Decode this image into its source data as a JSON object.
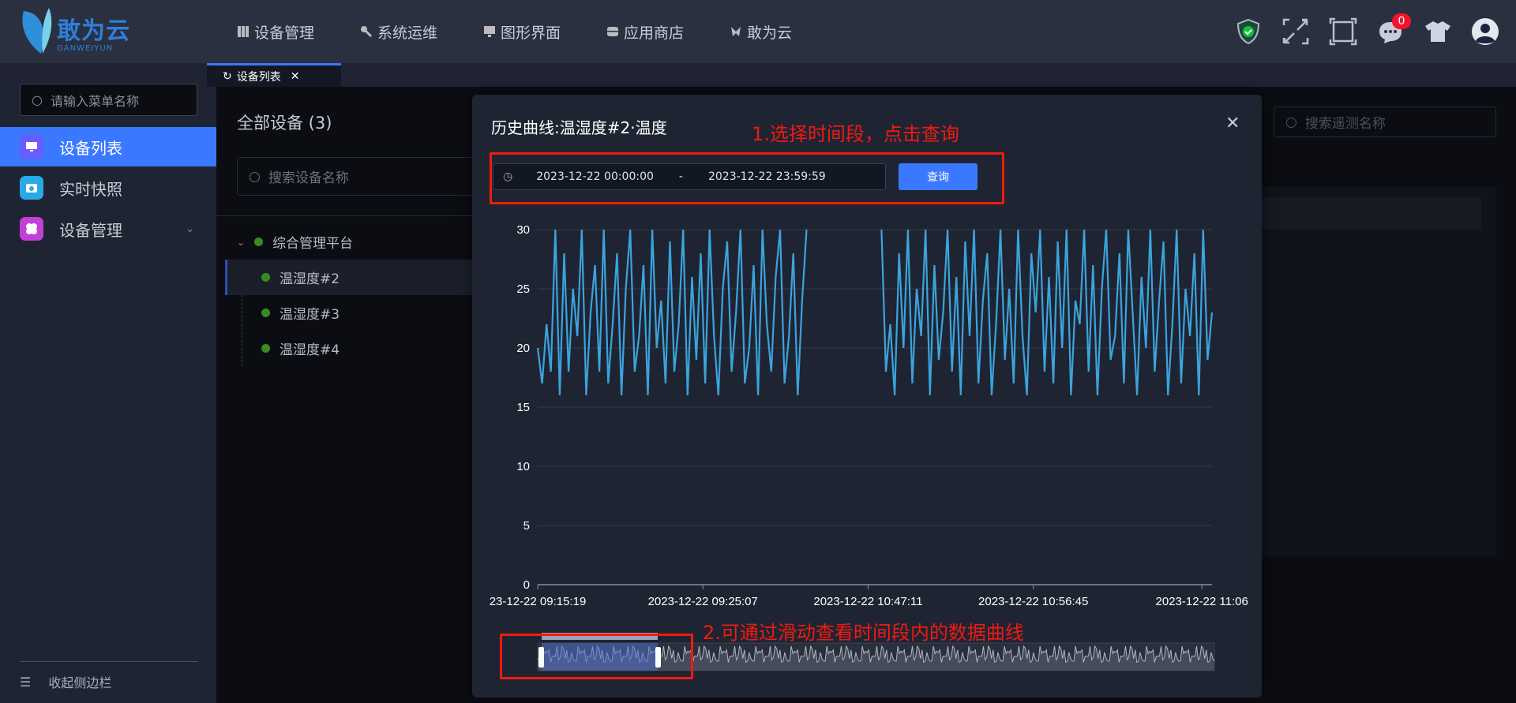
{
  "header": {
    "logo_text": "敢为云",
    "logo_subtext": "GANWEIYUN",
    "nav": [
      {
        "label": "设备管理",
        "icon": "columns-icon"
      },
      {
        "label": "系统运维",
        "icon": "wrench-icon"
      },
      {
        "label": "图形界面",
        "icon": "monitor-icon"
      },
      {
        "label": "应用商店",
        "icon": "store-icon"
      },
      {
        "label": "敢为云",
        "icon": "butterfly-icon"
      }
    ],
    "message_count": "0"
  },
  "tabs": [
    {
      "label": "设备列表"
    }
  ],
  "sidebar": {
    "search_placeholder": "请输入菜单名称",
    "items": [
      {
        "label": "设备列表",
        "icon": "monitor-icon",
        "color": "#6a5cff",
        "active": true
      },
      {
        "label": "实时快照",
        "icon": "camera-icon",
        "color": "#2aa8e8"
      },
      {
        "label": "设备管理",
        "icon": "clover-icon",
        "color": "#c040d8"
      }
    ],
    "collapse_label": "收起侧边栏"
  },
  "devices": {
    "title": "全部设备 (3)",
    "search_placeholder": "搜索设备名称",
    "root": "综合管理平台",
    "children": [
      "温湿度#2",
      "温湿度#3",
      "温湿度#4"
    ]
  },
  "right": {
    "search_placeholder": "搜索遥测名称"
  },
  "modal": {
    "title": "历史曲线:温湿度#2·温度",
    "annotation1": "1.选择时间段，点击查询",
    "annotation2": "2.可通过滑动查看时间段内的数据曲线",
    "start": "2023-12-22 00:00:00",
    "separator": "-",
    "end": "2023-12-22 23:59:59",
    "query_label": "查询"
  },
  "colors": {
    "accent": "#3a78ff",
    "line": "#3aa4dc",
    "annotation": "#f01a10"
  },
  "chart_data": {
    "type": "line",
    "title": "历史曲线:温湿度#2·温度",
    "ylim": [
      0,
      30
    ],
    "y_ticks": [
      "0",
      "5",
      "10",
      "15",
      "20",
      "25",
      "30"
    ],
    "x_ticks": [
      "23-12-22 09:15:19",
      "2023-12-22 09:25:07",
      "2023-12-22 10:47:11",
      "2023-12-22 10:56:45",
      "2023-12-22 11:06"
    ],
    "series": [
      {
        "name": "温度",
        "values": [
          20,
          17,
          22,
          18,
          30,
          16,
          28,
          18,
          25,
          21,
          30,
          16,
          23,
          27,
          18,
          30,
          17,
          22,
          28,
          16,
          25,
          30,
          18,
          21,
          27,
          16,
          30,
          20,
          24,
          17,
          29,
          18,
          22,
          30,
          16,
          26,
          19,
          28,
          17,
          30,
          21,
          16,
          25,
          29,
          18,
          23,
          30,
          17,
          20,
          27,
          16,
          30,
          22,
          18,
          26,
          30,
          17,
          21,
          28,
          16,
          24,
          30,
          null,
          null,
          null,
          null,
          null,
          null,
          null,
          null,
          null,
          null,
          null,
          null,
          null,
          null,
          null,
          null,
          30,
          18,
          22,
          16,
          28,
          20,
          30,
          17,
          25,
          21,
          30,
          16,
          27,
          19,
          23,
          30,
          18,
          26,
          16,
          29,
          21,
          30,
          17,
          24,
          28,
          16,
          22,
          30,
          19,
          25,
          17,
          30,
          21,
          16,
          28,
          23,
          30,
          18,
          26,
          17,
          29,
          20,
          30,
          16,
          24,
          22,
          30,
          18,
          27,
          16,
          25,
          30,
          19,
          21,
          28,
          17,
          30,
          23,
          16,
          26,
          20,
          30,
          18,
          24,
          29,
          16,
          22,
          30,
          17,
          25,
          21,
          28,
          16,
          30,
          19,
          23
        ]
      }
    ]
  }
}
